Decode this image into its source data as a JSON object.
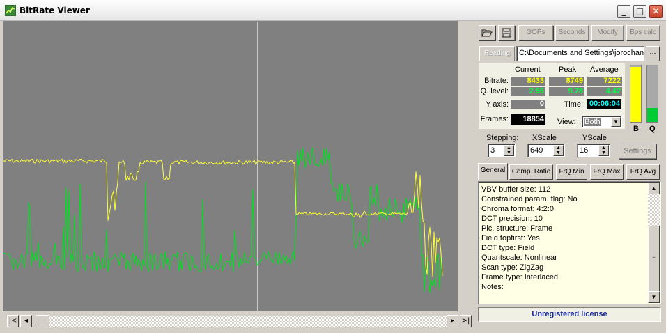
{
  "window": {
    "title": "BitRate  Viewer",
    "min": "_",
    "max": "□",
    "close": "✕"
  },
  "toolbar": {
    "open_icon": "folder-open-icon",
    "save_icon": "floppy-disk-icon",
    "gops": "GOPs",
    "seconds": "Seconds",
    "modify": "Modify",
    "bps_calc": "Bps calc",
    "reading": "Reading",
    "path": "C:\\Documents and Settings\\jorochan",
    "browse": "..."
  },
  "stats": {
    "col_current": "Current",
    "col_peak": "Peak",
    "col_average": "Average",
    "bitrate_label": "Bitrate:",
    "bitrate_current": "8433",
    "bitrate_peak": "8749",
    "bitrate_average": "7222",
    "qlevel_label": "Q. level:",
    "qlevel_current": "2.55",
    "qlevel_peak": "9.78",
    "qlevel_average": "4.42",
    "yaxis_label": "Y axis:",
    "yaxis_value": "0",
    "time_label": "Time:",
    "time_value": "00:06:04",
    "frames_label": "Frames:",
    "frames_value": "18854",
    "view_label": "View:",
    "view_value": "Both"
  },
  "meters": {
    "b_label": "B",
    "q_label": "Q",
    "b_level": 0.97,
    "q_level": 0.25,
    "b_color": "#ffff00",
    "q_color": "#00cc33"
  },
  "controls": {
    "stepping_label": "Stepping:",
    "stepping_value": "3",
    "xscale_label": "XScale",
    "xscale_value": "649",
    "yscale_label": "YScale",
    "yscale_value": "16",
    "settings": "Settings"
  },
  "tabs": [
    {
      "label": "General"
    },
    {
      "label": "Comp. Ratio"
    },
    {
      "label": "FrQ Min"
    },
    {
      "label": "FrQ Max"
    },
    {
      "label": "FrQ Avg"
    }
  ],
  "info_lines": [
    "VBV buffer size: 112",
    "Constrained param. flag: No",
    "Chroma format: 4:2:0",
    "DCT precision: 10",
    "Pic. structure: Frame",
    "Field topfirst: Yes",
    "DCT type: Field",
    "Quantscale: Nonlinear",
    "Scan type: ZigZag",
    "Frame type: Interlaced",
    "Notes:"
  ],
  "license": "Unregistered license",
  "colors": {
    "bitrate_line": "#ffff33",
    "qlevel_line": "#00e020",
    "graph_bg": "#808080",
    "cursor": "#e0e0e0"
  }
}
